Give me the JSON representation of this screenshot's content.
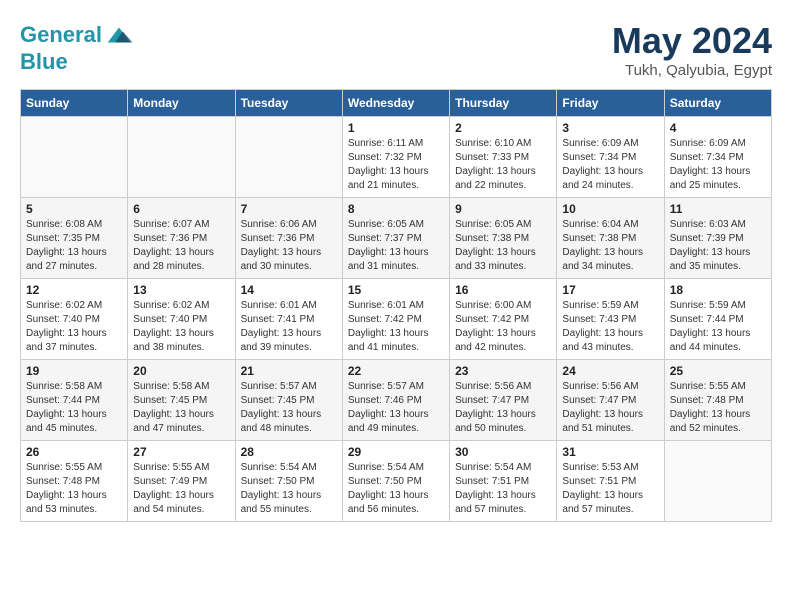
{
  "header": {
    "logo_line1": "General",
    "logo_line2": "Blue",
    "month_year": "May 2024",
    "location": "Tukh, Qalyubia, Egypt"
  },
  "weekdays": [
    "Sunday",
    "Monday",
    "Tuesday",
    "Wednesday",
    "Thursday",
    "Friday",
    "Saturday"
  ],
  "weeks": [
    [
      {
        "day": "",
        "info": ""
      },
      {
        "day": "",
        "info": ""
      },
      {
        "day": "",
        "info": ""
      },
      {
        "day": "1",
        "info": "Sunrise: 6:11 AM\nSunset: 7:32 PM\nDaylight: 13 hours\nand 21 minutes."
      },
      {
        "day": "2",
        "info": "Sunrise: 6:10 AM\nSunset: 7:33 PM\nDaylight: 13 hours\nand 22 minutes."
      },
      {
        "day": "3",
        "info": "Sunrise: 6:09 AM\nSunset: 7:34 PM\nDaylight: 13 hours\nand 24 minutes."
      },
      {
        "day": "4",
        "info": "Sunrise: 6:09 AM\nSunset: 7:34 PM\nDaylight: 13 hours\nand 25 minutes."
      }
    ],
    [
      {
        "day": "5",
        "info": "Sunrise: 6:08 AM\nSunset: 7:35 PM\nDaylight: 13 hours\nand 27 minutes."
      },
      {
        "day": "6",
        "info": "Sunrise: 6:07 AM\nSunset: 7:36 PM\nDaylight: 13 hours\nand 28 minutes."
      },
      {
        "day": "7",
        "info": "Sunrise: 6:06 AM\nSunset: 7:36 PM\nDaylight: 13 hours\nand 30 minutes."
      },
      {
        "day": "8",
        "info": "Sunrise: 6:05 AM\nSunset: 7:37 PM\nDaylight: 13 hours\nand 31 minutes."
      },
      {
        "day": "9",
        "info": "Sunrise: 6:05 AM\nSunset: 7:38 PM\nDaylight: 13 hours\nand 33 minutes."
      },
      {
        "day": "10",
        "info": "Sunrise: 6:04 AM\nSunset: 7:38 PM\nDaylight: 13 hours\nand 34 minutes."
      },
      {
        "day": "11",
        "info": "Sunrise: 6:03 AM\nSunset: 7:39 PM\nDaylight: 13 hours\nand 35 minutes."
      }
    ],
    [
      {
        "day": "12",
        "info": "Sunrise: 6:02 AM\nSunset: 7:40 PM\nDaylight: 13 hours\nand 37 minutes."
      },
      {
        "day": "13",
        "info": "Sunrise: 6:02 AM\nSunset: 7:40 PM\nDaylight: 13 hours\nand 38 minutes."
      },
      {
        "day": "14",
        "info": "Sunrise: 6:01 AM\nSunset: 7:41 PM\nDaylight: 13 hours\nand 39 minutes."
      },
      {
        "day": "15",
        "info": "Sunrise: 6:01 AM\nSunset: 7:42 PM\nDaylight: 13 hours\nand 41 minutes."
      },
      {
        "day": "16",
        "info": "Sunrise: 6:00 AM\nSunset: 7:42 PM\nDaylight: 13 hours\nand 42 minutes."
      },
      {
        "day": "17",
        "info": "Sunrise: 5:59 AM\nSunset: 7:43 PM\nDaylight: 13 hours\nand 43 minutes."
      },
      {
        "day": "18",
        "info": "Sunrise: 5:59 AM\nSunset: 7:44 PM\nDaylight: 13 hours\nand 44 minutes."
      }
    ],
    [
      {
        "day": "19",
        "info": "Sunrise: 5:58 AM\nSunset: 7:44 PM\nDaylight: 13 hours\nand 45 minutes."
      },
      {
        "day": "20",
        "info": "Sunrise: 5:58 AM\nSunset: 7:45 PM\nDaylight: 13 hours\nand 47 minutes."
      },
      {
        "day": "21",
        "info": "Sunrise: 5:57 AM\nSunset: 7:45 PM\nDaylight: 13 hours\nand 48 minutes."
      },
      {
        "day": "22",
        "info": "Sunrise: 5:57 AM\nSunset: 7:46 PM\nDaylight: 13 hours\nand 49 minutes."
      },
      {
        "day": "23",
        "info": "Sunrise: 5:56 AM\nSunset: 7:47 PM\nDaylight: 13 hours\nand 50 minutes."
      },
      {
        "day": "24",
        "info": "Sunrise: 5:56 AM\nSunset: 7:47 PM\nDaylight: 13 hours\nand 51 minutes."
      },
      {
        "day": "25",
        "info": "Sunrise: 5:55 AM\nSunset: 7:48 PM\nDaylight: 13 hours\nand 52 minutes."
      }
    ],
    [
      {
        "day": "26",
        "info": "Sunrise: 5:55 AM\nSunset: 7:48 PM\nDaylight: 13 hours\nand 53 minutes."
      },
      {
        "day": "27",
        "info": "Sunrise: 5:55 AM\nSunset: 7:49 PM\nDaylight: 13 hours\nand 54 minutes."
      },
      {
        "day": "28",
        "info": "Sunrise: 5:54 AM\nSunset: 7:50 PM\nDaylight: 13 hours\nand 55 minutes."
      },
      {
        "day": "29",
        "info": "Sunrise: 5:54 AM\nSunset: 7:50 PM\nDaylight: 13 hours\nand 56 minutes."
      },
      {
        "day": "30",
        "info": "Sunrise: 5:54 AM\nSunset: 7:51 PM\nDaylight: 13 hours\nand 57 minutes."
      },
      {
        "day": "31",
        "info": "Sunrise: 5:53 AM\nSunset: 7:51 PM\nDaylight: 13 hours\nand 57 minutes."
      },
      {
        "day": "",
        "info": ""
      }
    ]
  ]
}
